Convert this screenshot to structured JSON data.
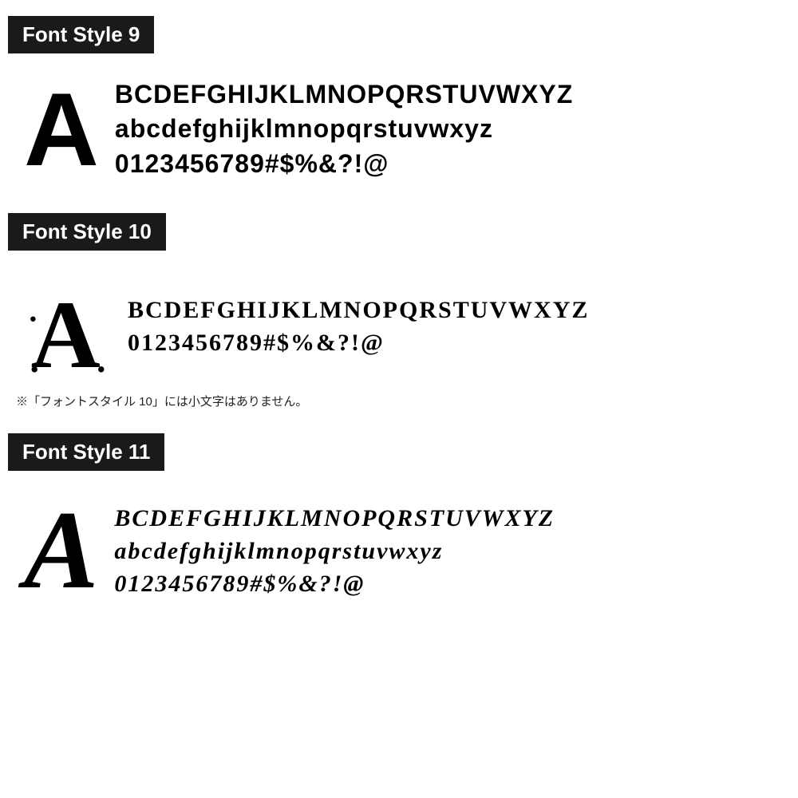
{
  "sections": [
    {
      "id": "style9",
      "label": "Font Style 9",
      "bigLetter": "A",
      "lines": [
        "BCDEFGHIJKLMNOPQRSTUVWXYZ",
        "abcdefghijklmnopqrstuvwxyz",
        "0123456789#$%&?!@"
      ],
      "note": null
    },
    {
      "id": "style10",
      "label": "Font Style 10",
      "bigLetter": "A",
      "lines": [
        "BCDEFGHIJKLMNOPQRSTUVWXYZ",
        "0123456789#$%&?!@"
      ],
      "note": "※「フォントスタイル 10」には小文字はありません。"
    },
    {
      "id": "style11",
      "label": "Font Style 11",
      "bigLetter": "A",
      "lines": [
        "BCDEFGHIJKLMNOPQRSTUVWXYZ",
        "abcdefghijklmnopqrstuvwxyz",
        "0123456789#$%&?!@"
      ],
      "note": null
    }
  ]
}
